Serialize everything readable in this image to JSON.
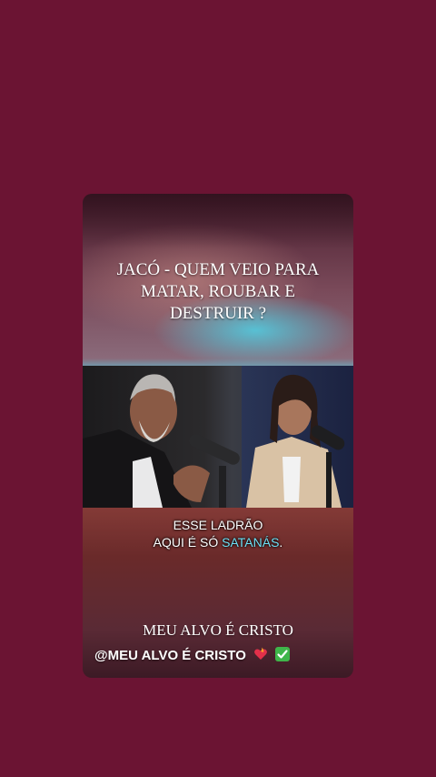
{
  "post": {
    "title_lines": [
      "JACÓ - QUEM VEIO PARA",
      "MATAR, ROUBAR E",
      "DESTRUIR ?"
    ],
    "subtitle_line1": "ESSE LADRÃO",
    "subtitle_line2_prefix": "AQUI É SÓ ",
    "subtitle_highlight": "SATANÁS",
    "subtitle_line2_suffix": ".",
    "footer_title": "MEU ALVO É CRISTO",
    "footer_handle": "@MEU ALVO É CRISTO"
  },
  "colors": {
    "background": "#6b1433",
    "subtitle_highlight": "#6fe0f5"
  },
  "icons": {
    "emoji1": "flaming-heart-icon",
    "emoji2": "check-mark-icon"
  }
}
